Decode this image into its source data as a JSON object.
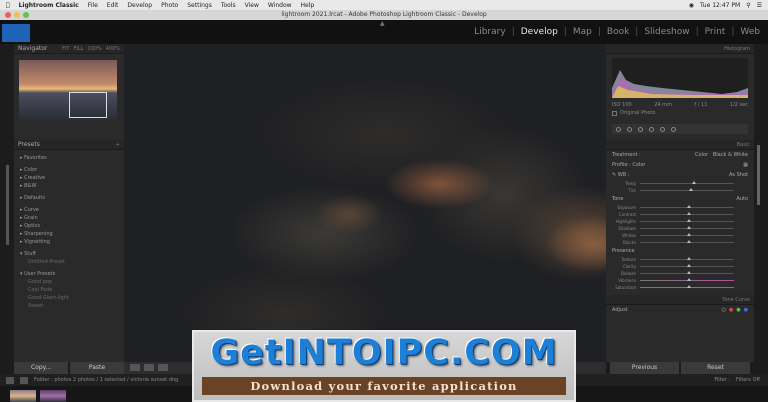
{
  "menubar": {
    "apple": "",
    "app": "Lightroom Classic",
    "items": [
      "File",
      "Edit",
      "Develop",
      "Photo",
      "Settings",
      "Tools",
      "View",
      "Window",
      "Help"
    ],
    "time": "Tue 12:47 PM"
  },
  "window": {
    "title": "lightroom 2021.lrcat - Adobe Photoshop Lightroom Classic - Develop"
  },
  "modules": {
    "items": [
      "Library",
      "Develop",
      "Map",
      "Book",
      "Slideshow",
      "Print",
      "Web"
    ],
    "active": "Develop"
  },
  "left_panel": {
    "navigator": {
      "title": "Navigator",
      "fit": "FIT",
      "fill": "FILL",
      "zoom1": "100%",
      "zoom2": "400%"
    },
    "presets": {
      "title": "Presets",
      "groups": [
        "Favorites",
        "Color",
        "Creative",
        "B&W",
        "Defaults",
        "Curve",
        "Grain",
        "Optics",
        "Sharpening",
        "Vignetting",
        "Stuff",
        "User Presets"
      ],
      "sub_stuff": "Untitled Preset",
      "sub_user": [
        "Good pop",
        "Cool Fade",
        "Good Glam-light",
        "Sweet"
      ]
    },
    "copy_label": "Copy...",
    "paste_label": "Paste"
  },
  "right_panel": {
    "histogram_title": "Histogram",
    "hist_info": [
      "ISO 100",
      "24 mm",
      "f / 11",
      "1/2 sec"
    ],
    "original_photo": "Original Photo",
    "basic_title": "Basic",
    "treatment": "Treatment :",
    "color": "Color",
    "bw": "Black & White",
    "profile": "Profile :",
    "profile_value": "Color",
    "wb": "WB :",
    "wb_value": "As Shot",
    "temp": "Temp",
    "tint": "Tint",
    "tone": "Tone",
    "auto": "Auto",
    "tone_sliders": [
      "Exposure",
      "Contrast",
      "Highlights",
      "Shadows",
      "Whites",
      "Blacks"
    ],
    "presence": "Presence",
    "presence_sliders": [
      "Texture",
      "Clarity",
      "Dehaze",
      "Vibrance",
      "Saturation"
    ],
    "tone_curve": "Tone Curve",
    "adjust": "Adjust",
    "previous_label": "Previous",
    "reset_label": "Reset"
  },
  "filmstrip": {
    "info": "Folder : photos   2 photos / 1 selected / victoria sunset.dng",
    "filter": "Filter :",
    "filter_value": "Filters Off"
  },
  "watermark": {
    "title": "GetINTOIPC.COM",
    "subtitle": "Download your favorite application"
  },
  "colors": {
    "accent_blue": "#1d7fd6",
    "banner_brown": "#6a4226",
    "identity_plate": "#1e63b8"
  }
}
